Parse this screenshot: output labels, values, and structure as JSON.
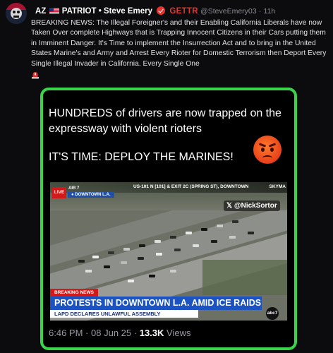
{
  "author": {
    "name_prefix": "AZ",
    "name_suffix": "PATRIOT • Steve Emery",
    "platform": "GETTR",
    "handle": "@SteveEmery03",
    "separator": "·",
    "time": "11h"
  },
  "post": {
    "text": "BREAKING NEWS: The Illegal Foreigner's and their Enabling California Liberals have now Taken Over complete Highways that is Trapping Innocent Citizens in their Cars putting them in Imminent Danger. It's Time to implement the Insurrection Act and to bring in the United States Marine's and Army and Arrest Every Rioter for Domestic Terrorism then Deport Every Single Illegal Invader in California. Every Single One"
  },
  "card": {
    "headline": "HUNDREDS of drivers are now trapped on the expressway with violent rioters",
    "cta": "IT'S TIME: DEPLOY THE MARINES!",
    "border_color": "#3bd34a",
    "broadcast": {
      "route": "US-101 N [101] & EXIT 2C (SPRING ST), DOWNTOWN",
      "sky": "SKYMA",
      "live": "LIVE",
      "air": "AIR 7",
      "location": "DOWNTOWN L.A.",
      "watermark": "@NickSortor",
      "breaking": "BREAKING NEWS",
      "headline": "PROTESTS IN DOWNTOWN L.A. AMID ICE RAIDS",
      "subline": "LAPD DECLARES UNLAWFUL ASSEMBLY",
      "network": "abc7"
    },
    "meta": {
      "time": "6:46 PM",
      "date": "08 Jun 25",
      "views_count": "13.3K",
      "views_label": "Views"
    }
  },
  "icons": [
    "avatar",
    "us-flag-icon",
    "verified-badge-icon",
    "siren-icon",
    "angry-face-emoji",
    "x-logo-icon"
  ],
  "colors": {
    "accent_red": "#e5342f",
    "news_blue": "#1b53c2",
    "border_green": "#3bd34a"
  }
}
